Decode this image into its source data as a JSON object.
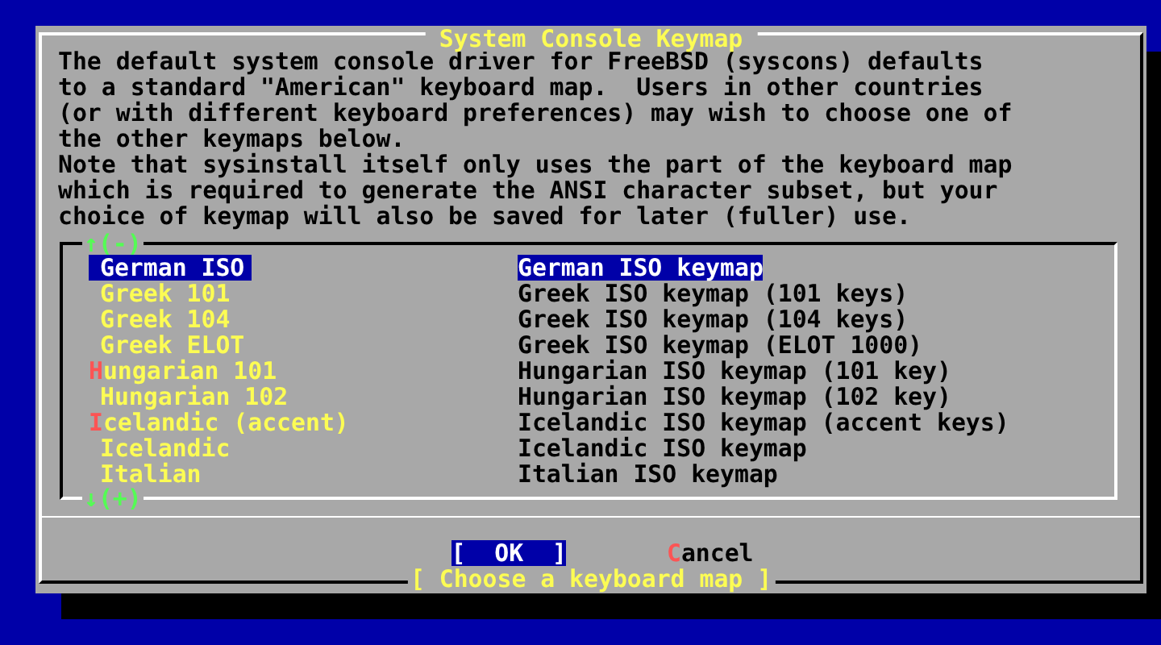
{
  "dialog": {
    "title": "System Console Keymap",
    "description": [
      "The default system console driver for FreeBSD (syscons) defaults",
      "to a standard \"American\" keyboard map.  Users in other countries",
      "(or with different keyboard preferences) may wish to choose one of",
      "the other keymaps below.",
      "Note that sysinstall itself only uses the part of the keyboard map",
      "which is required to generate the ANSI character subset, but your",
      "choice of keymap will also be saved for later (fuller) use."
    ],
    "scroll_up": "↑(-)",
    "scroll_down": "↓(+)",
    "items": [
      {
        "name": "German ISO",
        "description": "German ISO keymap",
        "selected": true,
        "hotkey": false
      },
      {
        "name": "Greek 101",
        "description": "Greek ISO keymap (101 keys)",
        "selected": false,
        "hotkey": false
      },
      {
        "name": "Greek 104",
        "description": "Greek ISO keymap (104 keys)",
        "selected": false,
        "hotkey": false
      },
      {
        "name": "Greek ELOT",
        "description": "Greek ISO keymap (ELOT 1000)",
        "selected": false,
        "hotkey": false
      },
      {
        "name": "Hungarian 101",
        "description": "Hungarian ISO keymap (101 key)",
        "selected": false,
        "hotkey": true
      },
      {
        "name": "Hungarian 102",
        "description": "Hungarian ISO keymap (102 key)",
        "selected": false,
        "hotkey": false
      },
      {
        "name": "Icelandic (accent)",
        "description": "Icelandic ISO keymap (accent keys)",
        "selected": false,
        "hotkey": true
      },
      {
        "name": "Icelandic",
        "description": "Icelandic ISO keymap",
        "selected": false,
        "hotkey": false
      },
      {
        "name": "Italian",
        "description": "Italian ISO keymap",
        "selected": false,
        "hotkey": false
      }
    ],
    "buttons": [
      {
        "label": "[  OK  ]",
        "selected": true,
        "hotkey": false
      },
      {
        "label": "Cancel",
        "selected": false,
        "hotkey": true
      }
    ],
    "status": "[ Choose a keyboard map ]"
  }
}
